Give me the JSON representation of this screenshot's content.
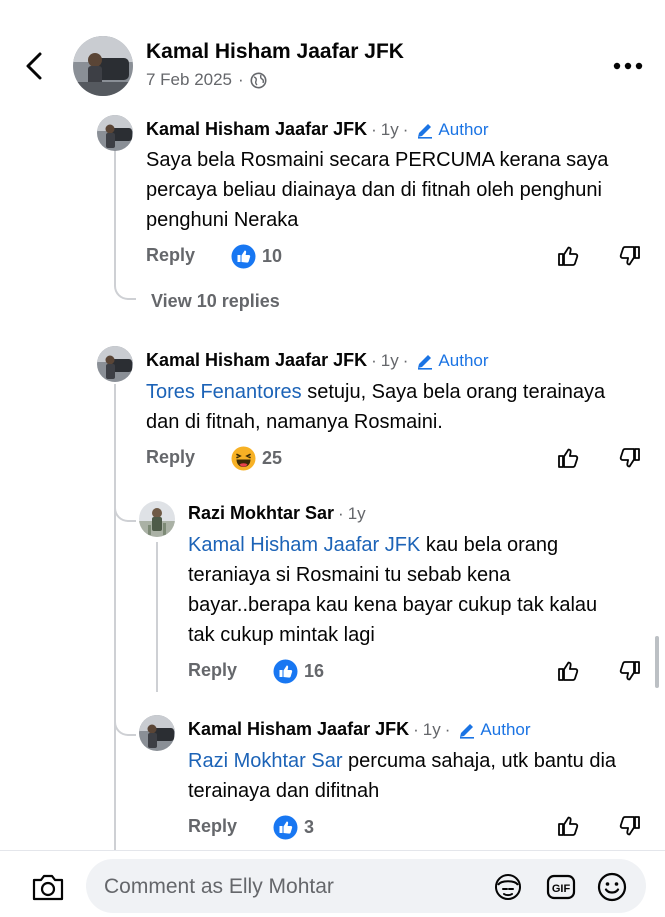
{
  "header": {
    "name": "Kamal Hisham Jaafar JFK",
    "date": "7 Feb 2025",
    "date_sep": "·"
  },
  "comments": [
    {
      "name": "Kamal Hisham Jaafar JFK",
      "time": "1y",
      "author_label": "Author",
      "mention": "",
      "text": "Saya bela Rosmaini secara PERCUMA kerana saya percaya beliau diainaya dan di fitnah oleh penghuni penghuni Neraka",
      "reply_label": "Reply",
      "reaction": "like",
      "reaction_count": "10",
      "view_replies": "View 10 replies"
    },
    {
      "name": "Kamal Hisham Jaafar JFK",
      "time": "1y",
      "author_label": "Author",
      "mention": "Tores Fenantores",
      "text": " setuju, Saya bela orang terainaya dan di fitnah, namanya Rosmaini.",
      "reply_label": "Reply",
      "reaction": "haha",
      "reaction_count": "25"
    },
    {
      "name": "Razi Mokhtar Sar",
      "time": "1y",
      "author_label": "",
      "mention": "Kamal Hisham Jaafar JFK",
      "text": " kau bela orang teraniaya si Rosmaini tu sebab kena bayar..berapa kau kena bayar cukup tak kalau tak cukup mintak lagi",
      "reply_label": "Reply",
      "reaction": "like",
      "reaction_count": "16"
    },
    {
      "name": "Kamal Hisham Jaafar JFK",
      "time": "1y",
      "author_label": "Author",
      "mention": "Razi Mokhtar Sar",
      "text": " percuma sahaja, utk bantu dia terainaya dan difitnah",
      "reply_label": "Reply",
      "reaction": "like",
      "reaction_count": "3"
    }
  ],
  "composer": {
    "placeholder": "Comment as Elly Mohtar",
    "icons": [
      "camera-icon",
      "avatar-sticker-icon",
      "gif-icon",
      "emoji-icon"
    ]
  },
  "colors": {
    "link": "#1c63b7",
    "author": "#1b74e4",
    "like": "#1877f2",
    "muted": "#65676b"
  }
}
